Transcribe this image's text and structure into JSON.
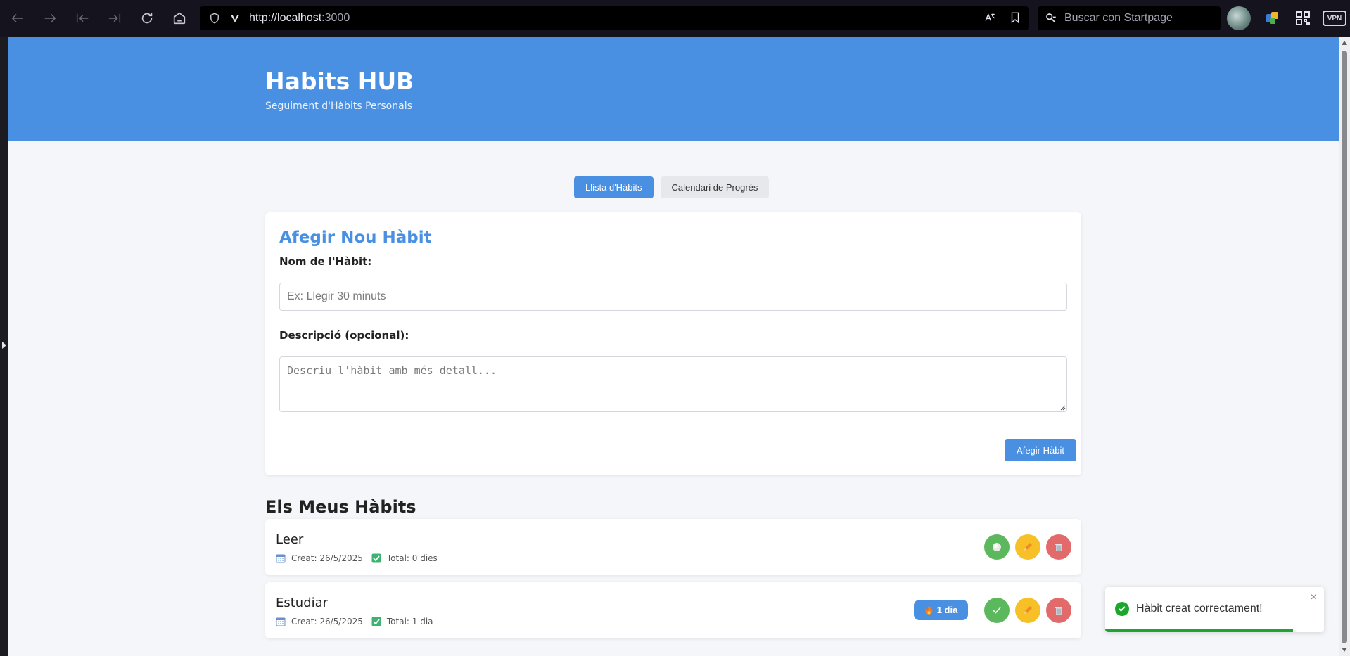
{
  "browser": {
    "url_host": "http://localhost",
    "url_port": ":3000",
    "search_placeholder": "Buscar con Startpage",
    "vpn_label": "VPN"
  },
  "header": {
    "title": "Habits HUB",
    "subtitle": "Seguiment d'Hàbits Personals"
  },
  "tabs": [
    {
      "label": "Llista d'Hàbits",
      "active": true
    },
    {
      "label": "Calendari de Progrés",
      "active": false
    }
  ],
  "form": {
    "title": "Afegir Nou Hàbit",
    "name_label": "Nom de l'Hàbit:",
    "name_placeholder": "Ex: Llegir 30 minuts",
    "description_label": "Descripció (opcional):",
    "description_placeholder": "Descriu l'hàbit amb més detall...",
    "submit_label": "Afegir Hàbit"
  },
  "habits_section": {
    "title": "Els Meus Hàbits"
  },
  "habits": [
    {
      "name": "Leer",
      "created": "Creat: 26/5/2025",
      "total": "Total: 0 dies",
      "streak": null,
      "completed_today": false
    },
    {
      "name": "Estudiar",
      "created": "Creat: 26/5/2025",
      "total": "Total: 1 dia",
      "streak": "1 dia",
      "completed_today": true
    }
  ],
  "toast": {
    "message": "Hàbit creat correctament!",
    "close_label": "×",
    "progress": 0.86
  },
  "colors": {
    "primary": "#4a90e2",
    "complete": "#5cb85c",
    "edit": "#f6c026",
    "delete": "#e26a6a",
    "toast_success": "#1aa72b"
  }
}
